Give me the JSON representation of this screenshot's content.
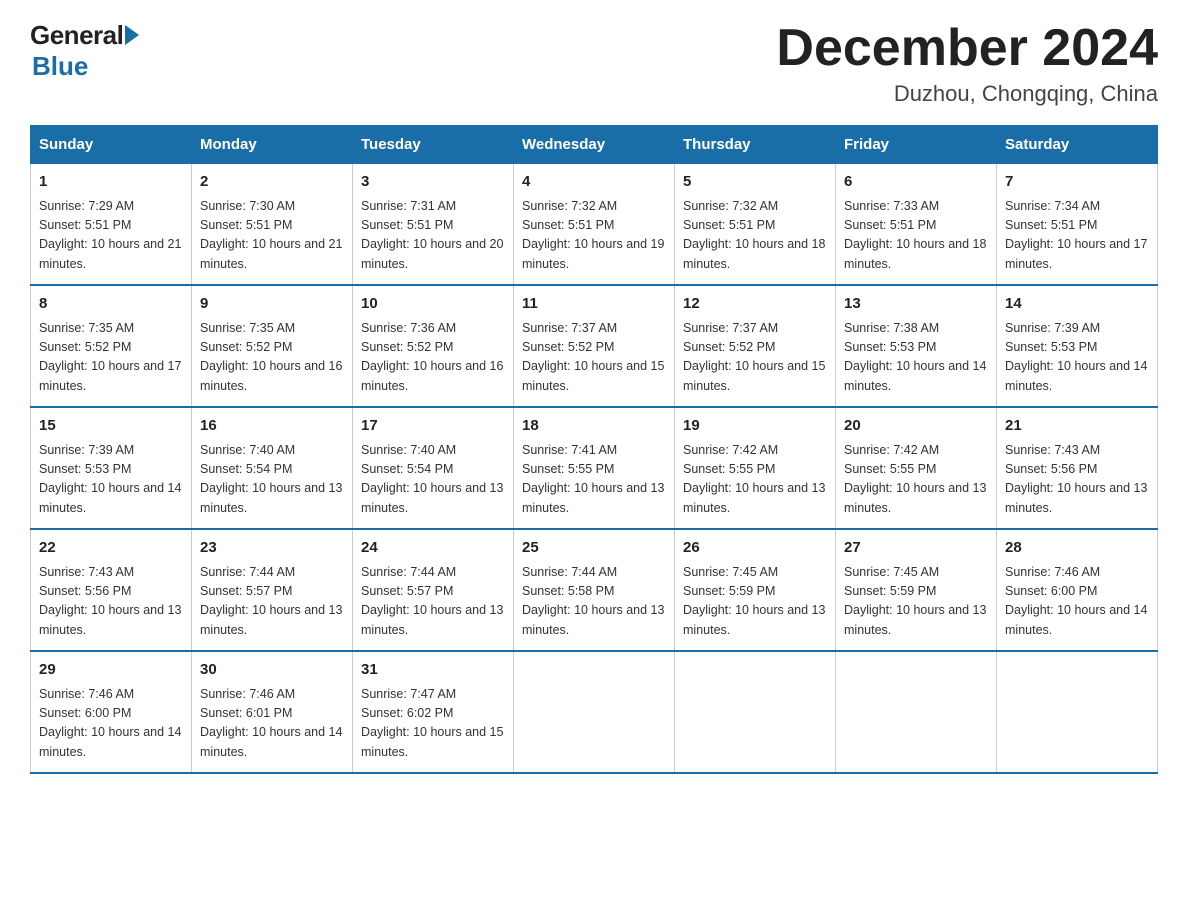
{
  "logo": {
    "general": "General",
    "blue": "Blue"
  },
  "title": {
    "month_year": "December 2024",
    "location": "Duzhou, Chongqing, China"
  },
  "headers": [
    "Sunday",
    "Monday",
    "Tuesday",
    "Wednesday",
    "Thursday",
    "Friday",
    "Saturday"
  ],
  "weeks": [
    [
      {
        "day": "1",
        "sunrise": "7:29 AM",
        "sunset": "5:51 PM",
        "daylight": "10 hours and 21 minutes."
      },
      {
        "day": "2",
        "sunrise": "7:30 AM",
        "sunset": "5:51 PM",
        "daylight": "10 hours and 21 minutes."
      },
      {
        "day": "3",
        "sunrise": "7:31 AM",
        "sunset": "5:51 PM",
        "daylight": "10 hours and 20 minutes."
      },
      {
        "day": "4",
        "sunrise": "7:32 AM",
        "sunset": "5:51 PM",
        "daylight": "10 hours and 19 minutes."
      },
      {
        "day": "5",
        "sunrise": "7:32 AM",
        "sunset": "5:51 PM",
        "daylight": "10 hours and 18 minutes."
      },
      {
        "day": "6",
        "sunrise": "7:33 AM",
        "sunset": "5:51 PM",
        "daylight": "10 hours and 18 minutes."
      },
      {
        "day": "7",
        "sunrise": "7:34 AM",
        "sunset": "5:51 PM",
        "daylight": "10 hours and 17 minutes."
      }
    ],
    [
      {
        "day": "8",
        "sunrise": "7:35 AM",
        "sunset": "5:52 PM",
        "daylight": "10 hours and 17 minutes."
      },
      {
        "day": "9",
        "sunrise": "7:35 AM",
        "sunset": "5:52 PM",
        "daylight": "10 hours and 16 minutes."
      },
      {
        "day": "10",
        "sunrise": "7:36 AM",
        "sunset": "5:52 PM",
        "daylight": "10 hours and 16 minutes."
      },
      {
        "day": "11",
        "sunrise": "7:37 AM",
        "sunset": "5:52 PM",
        "daylight": "10 hours and 15 minutes."
      },
      {
        "day": "12",
        "sunrise": "7:37 AM",
        "sunset": "5:52 PM",
        "daylight": "10 hours and 15 minutes."
      },
      {
        "day": "13",
        "sunrise": "7:38 AM",
        "sunset": "5:53 PM",
        "daylight": "10 hours and 14 minutes."
      },
      {
        "day": "14",
        "sunrise": "7:39 AM",
        "sunset": "5:53 PM",
        "daylight": "10 hours and 14 minutes."
      }
    ],
    [
      {
        "day": "15",
        "sunrise": "7:39 AM",
        "sunset": "5:53 PM",
        "daylight": "10 hours and 14 minutes."
      },
      {
        "day": "16",
        "sunrise": "7:40 AM",
        "sunset": "5:54 PM",
        "daylight": "10 hours and 13 minutes."
      },
      {
        "day": "17",
        "sunrise": "7:40 AM",
        "sunset": "5:54 PM",
        "daylight": "10 hours and 13 minutes."
      },
      {
        "day": "18",
        "sunrise": "7:41 AM",
        "sunset": "5:55 PM",
        "daylight": "10 hours and 13 minutes."
      },
      {
        "day": "19",
        "sunrise": "7:42 AM",
        "sunset": "5:55 PM",
        "daylight": "10 hours and 13 minutes."
      },
      {
        "day": "20",
        "sunrise": "7:42 AM",
        "sunset": "5:55 PM",
        "daylight": "10 hours and 13 minutes."
      },
      {
        "day": "21",
        "sunrise": "7:43 AM",
        "sunset": "5:56 PM",
        "daylight": "10 hours and 13 minutes."
      }
    ],
    [
      {
        "day": "22",
        "sunrise": "7:43 AM",
        "sunset": "5:56 PM",
        "daylight": "10 hours and 13 minutes."
      },
      {
        "day": "23",
        "sunrise": "7:44 AM",
        "sunset": "5:57 PM",
        "daylight": "10 hours and 13 minutes."
      },
      {
        "day": "24",
        "sunrise": "7:44 AM",
        "sunset": "5:57 PM",
        "daylight": "10 hours and 13 minutes."
      },
      {
        "day": "25",
        "sunrise": "7:44 AM",
        "sunset": "5:58 PM",
        "daylight": "10 hours and 13 minutes."
      },
      {
        "day": "26",
        "sunrise": "7:45 AM",
        "sunset": "5:59 PM",
        "daylight": "10 hours and 13 minutes."
      },
      {
        "day": "27",
        "sunrise": "7:45 AM",
        "sunset": "5:59 PM",
        "daylight": "10 hours and 13 minutes."
      },
      {
        "day": "28",
        "sunrise": "7:46 AM",
        "sunset": "6:00 PM",
        "daylight": "10 hours and 14 minutes."
      }
    ],
    [
      {
        "day": "29",
        "sunrise": "7:46 AM",
        "sunset": "6:00 PM",
        "daylight": "10 hours and 14 minutes."
      },
      {
        "day": "30",
        "sunrise": "7:46 AM",
        "sunset": "6:01 PM",
        "daylight": "10 hours and 14 minutes."
      },
      {
        "day": "31",
        "sunrise": "7:47 AM",
        "sunset": "6:02 PM",
        "daylight": "10 hours and 15 minutes."
      },
      null,
      null,
      null,
      null
    ]
  ]
}
